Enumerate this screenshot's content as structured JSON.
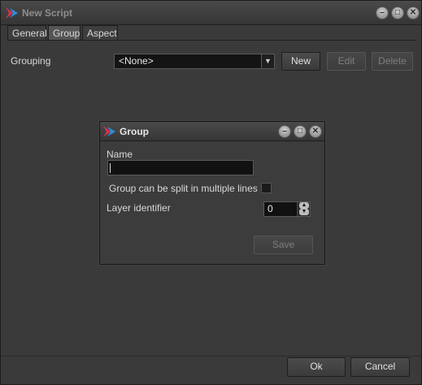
{
  "window": {
    "title": "New Script",
    "controls": [
      "minimize-icon",
      "maximize-icon",
      "close-icon"
    ]
  },
  "tabs": [
    {
      "label": "General",
      "active": false
    },
    {
      "label": "Group",
      "active": true
    },
    {
      "label": "Aspect",
      "active": false
    }
  ],
  "grouping": {
    "label": "Grouping",
    "selected": "<None>",
    "new_label": "New",
    "edit_label": "Edit",
    "delete_label": "Delete"
  },
  "dialog": {
    "title": "Group",
    "name_label": "Name",
    "name_value": "",
    "split_label": "Group can be split in multiple lines",
    "split_checked": false,
    "layer_label": "Layer identifier",
    "layer_value": "0",
    "save_label": "Save"
  },
  "footer": {
    "ok_label": "Ok",
    "cancel_label": "Cancel"
  },
  "colors": {
    "background": "#3a3a3a",
    "titlebar": "#404040",
    "field": "#141414",
    "icon_blue": "#2a8ee0",
    "icon_red": "#e0304a"
  }
}
